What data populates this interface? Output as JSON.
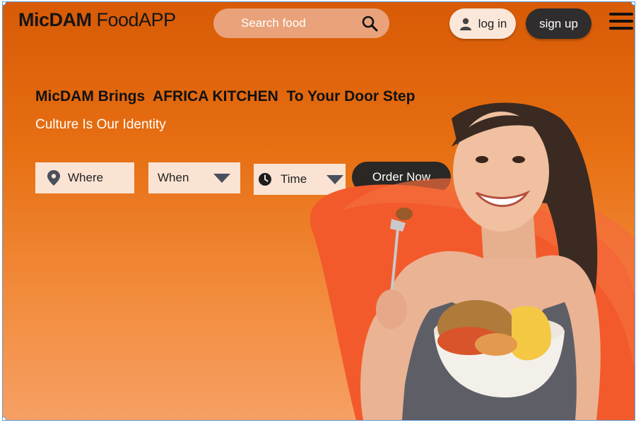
{
  "header": {
    "logo_bold": "MicDAM",
    "logo_rest": "FoodAPP",
    "search_placeholder": "Search food",
    "login_label": "log in",
    "signup_label": "sign up"
  },
  "hero": {
    "headline": "MicDAM Brings  AFRICA KITCHEN  To Your Door Step",
    "tagline": "Culture Is Our Identity"
  },
  "booking": {
    "where_label": "Where",
    "when_label": "When",
    "time_label": "Time",
    "order_label": "Order Now"
  },
  "icons": {
    "search": "search-icon",
    "user": "user-icon",
    "menu": "hamburger-menu-icon",
    "location": "location-pin-icon",
    "clock": "clock-icon",
    "dropdown": "dropdown-triangle-icon"
  },
  "colors": {
    "accent": "#e76f12",
    "dark": "#2f2d2d",
    "field_bg": "#fbe3d3"
  }
}
